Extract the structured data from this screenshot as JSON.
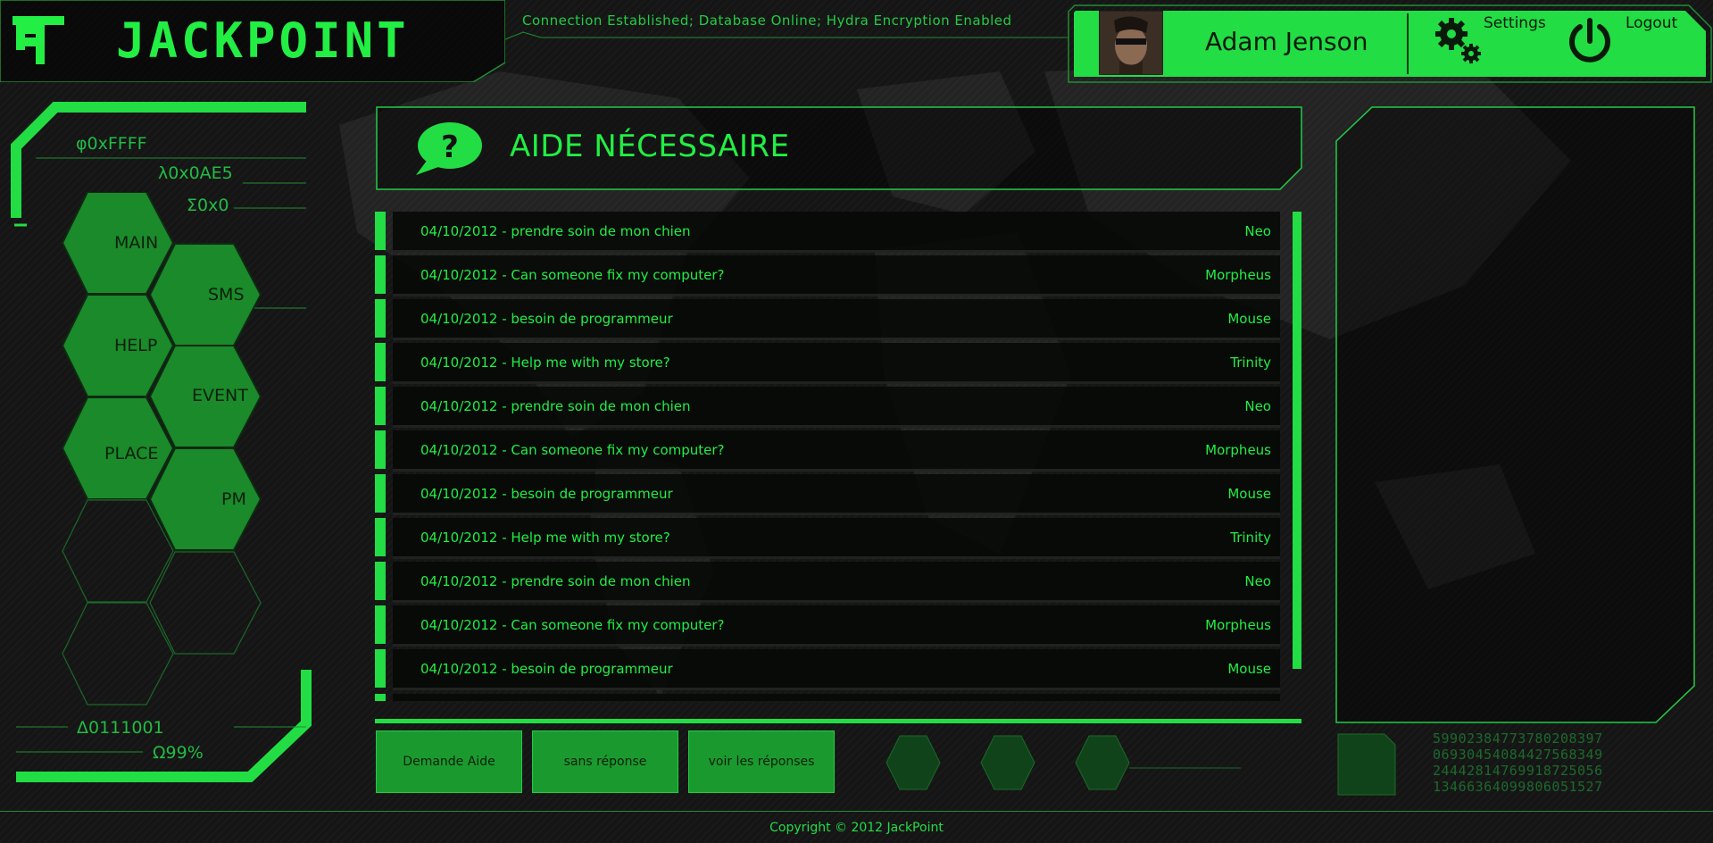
{
  "brand": {
    "name": "JACKPOINT"
  },
  "status": "Connection Established; Database Online; Hydra Encryption Enabled",
  "user": {
    "name": "Adam Jenson"
  },
  "header_actions": {
    "settings": "Settings",
    "logout": "Logout"
  },
  "left_codes": {
    "top": [
      "φ0xFFFF",
      "λ0x0AE5",
      "Σ0x0"
    ],
    "bottom": [
      "Δ0111001",
      "Ω99%"
    ]
  },
  "nav": [
    "MAIN",
    "SMS",
    "HELP",
    "EVENT",
    "PLACE",
    "PM"
  ],
  "page": {
    "title": "AIDE NÉCESSAIRE",
    "icon": "question-bubble-icon"
  },
  "requests": [
    {
      "text": "04/10/2012 - prendre soin de mon chien",
      "author": "Neo"
    },
    {
      "text": "04/10/2012 - Can someone fix my computer?",
      "author": "Morpheus"
    },
    {
      "text": "04/10/2012 - besoin de programmeur",
      "author": "Mouse"
    },
    {
      "text": "04/10/2012 - Help me with my store?",
      "author": "Trinity"
    },
    {
      "text": "04/10/2012 - prendre soin de mon chien",
      "author": "Neo"
    },
    {
      "text": "04/10/2012 - Can someone fix my computer?",
      "author": "Morpheus"
    },
    {
      "text": "04/10/2012 - besoin de programmeur",
      "author": "Mouse"
    },
    {
      "text": "04/10/2012 - Help me with my store?",
      "author": "Trinity"
    },
    {
      "text": "04/10/2012 - prendre soin de mon chien",
      "author": "Neo"
    },
    {
      "text": "04/10/2012 - Can someone fix my computer?",
      "author": "Morpheus"
    },
    {
      "text": "04/10/2012 - besoin de programmeur",
      "author": "Mouse"
    }
  ],
  "actions": [
    "Demande Aide",
    "sans réponse",
    "voir les réponses"
  ],
  "digits": [
    "59902384773780208397",
    "06930454084427568349",
    "24442814769918725056",
    "13466364099806051527"
  ],
  "footer": "Copyright © 2012 JackPoint",
  "colors": {
    "accent": "#22dd44",
    "accent_dark": "#1a9a2e",
    "background": "#151515"
  }
}
